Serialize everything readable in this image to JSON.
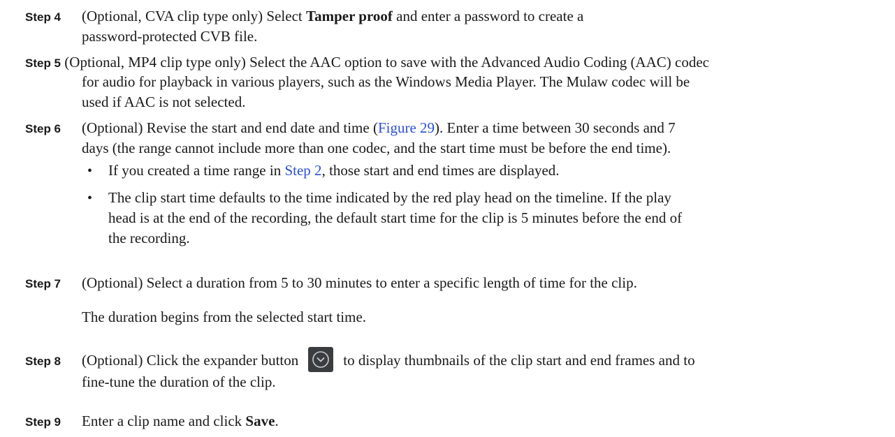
{
  "steps": {
    "s4": {
      "label": "Step 4",
      "line1_pre": "(Optional, CVA clip type only) Select ",
      "line1_bold": "Tamper proof",
      "line1_post": " and enter a password to create a",
      "line2": "password-protected CVB file."
    },
    "s5": {
      "label": "Step 5",
      "line1": "(Optional, MP4 clip type only) Select the AAC option to save with the Advanced Audio Coding (AAC) codec",
      "line2": "for audio for playback in various players, such as the Windows Media Player. The Mulaw codec will be",
      "line3": "used if AAC is not selected."
    },
    "s6": {
      "label": "Step 6",
      "line1_pre": "(Optional) Revise the start and end date and time (",
      "line1_link": "Figure 29",
      "line1_post": "). Enter a time between 30 seconds and 7",
      "line2": "days (the range cannot include more than one codec, and the start time must be before the end time).",
      "bullet1_pre": "If you created a time range in ",
      "bullet1_link": "Step 2",
      "bullet1_post": ", those start and end times are displayed.",
      "bullet2_line1": "The clip start time defaults to the time indicated by the red play head on the timeline. If the play",
      "bullet2_line2": "head is at the end of the recording, the default start time for the clip is 5 minutes before the end of",
      "bullet2_line3": "the recording."
    },
    "s7": {
      "label": "Step 7",
      "line1": "(Optional) Select a duration from 5 to 30 minutes to enter a specific length of time for the clip.",
      "line2": "The duration begins from the selected start time."
    },
    "s8": {
      "label": "Step 8",
      "line1_pre": "(Optional) Click the expander button",
      "line1_post": "to display thumbnails of the clip start and end frames and to",
      "line2": "fine-tune the duration of the clip."
    },
    "s9": {
      "label": "Step 9",
      "text_pre": "Enter a clip name and click ",
      "text_bold": "Save",
      "text_post": "."
    }
  },
  "colors": {
    "text": "#1a1a1a",
    "link": "#2b4fd6",
    "expander_bg": "#3a3d40"
  },
  "icons": {
    "expander": "chevron-down-circle-icon",
    "bullet": "bullet-dot"
  }
}
